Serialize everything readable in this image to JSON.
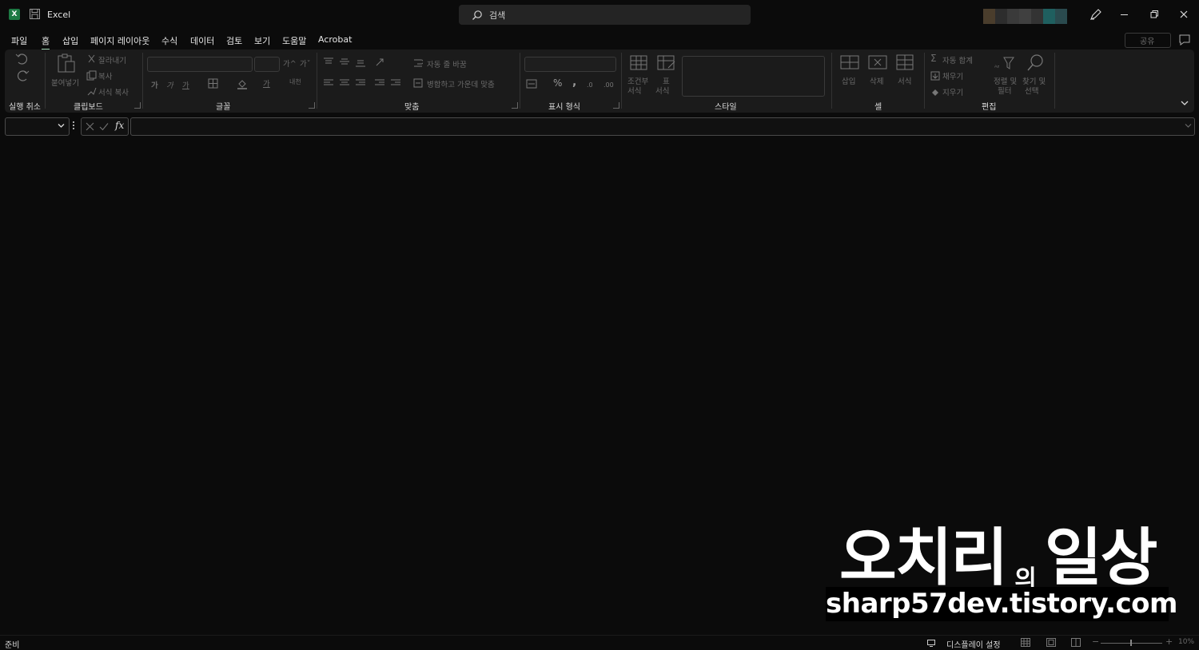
{
  "app": {
    "title": "Excel",
    "icon_letter": "X",
    "search_placeholder": "검색"
  },
  "tabs": [
    {
      "label": "파일"
    },
    {
      "label": "홈"
    },
    {
      "label": "삽입"
    },
    {
      "label": "페이지 레이아웃"
    },
    {
      "label": "수식"
    },
    {
      "label": "데이터"
    },
    {
      "label": "검토"
    },
    {
      "label": "보기"
    },
    {
      "label": "도움말"
    },
    {
      "label": "Acrobat"
    }
  ],
  "active_tab": "홈",
  "share_label": "공유",
  "ribbon": {
    "groups": {
      "undo": "실행 취소",
      "clipboard": "클립보드",
      "font": "글꼴",
      "alignment": "맞춤",
      "number": "표시 형식",
      "styles": "스타일",
      "cells": "셀",
      "editing": "편집"
    },
    "clipboard": {
      "paste": "붙여넣기",
      "cut": "잘라내기",
      "copy": "복사",
      "format_painter": "서식 복사"
    },
    "font": {
      "bold": "가",
      "italic": "가",
      "underline": "가",
      "grow": "가^",
      "shrink": "가ˇ",
      "font_color": "가",
      "phonetic": "내천"
    },
    "alignment": {
      "wrap_text": "자동 줄 바꿈",
      "merge_center": "병합하고 가운데 맞춤"
    },
    "number": {
      "percent": "%",
      "comma": ","
    },
    "styles": {
      "conditional_line1": "조건부",
      "conditional_line2": "서식",
      "table_line1": "표",
      "table_line2": "서식"
    },
    "cells": {
      "insert": "삽입",
      "delete": "삭제",
      "format": "서식"
    },
    "editing": {
      "autosum": "자동 합계",
      "fill": "채우기",
      "clear": "지우기",
      "sort_line1": "정렬 및",
      "sort_line2": "필터",
      "find_line1": "찾기 및",
      "find_line2": "선택"
    }
  },
  "formula_bar": {
    "fx": "fx"
  },
  "watermark": {
    "name": "오치리",
    "of": "의",
    "title": "일상",
    "url": "sharp57dev.tistory.com"
  },
  "status_bar": {
    "status": "준비",
    "display_settings": "디스플레이 설정",
    "zoom": "10%"
  },
  "colors": {
    "background": "#0b0b0b",
    "ribbon": "#1b1b1b",
    "excel_green": "#1d7a44",
    "active_tab_underline": "#9fd5b3"
  }
}
